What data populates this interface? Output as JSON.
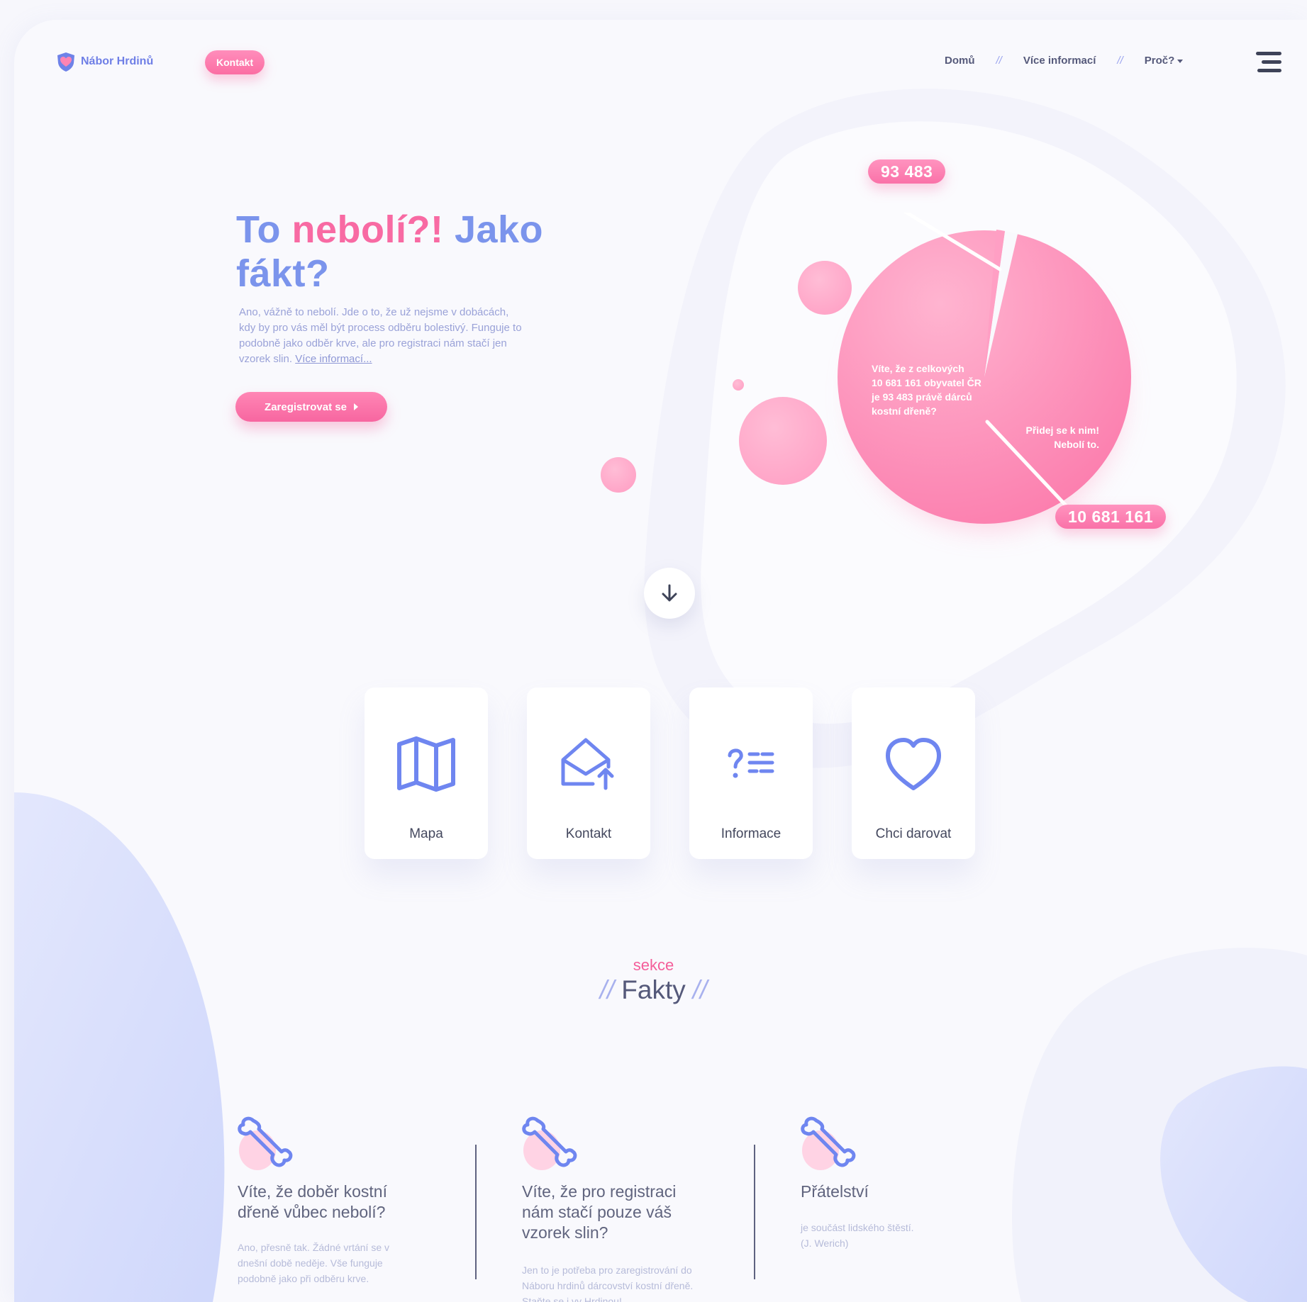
{
  "header": {
    "logo_text": "Nábor Hrdinů",
    "contact_pill": "Kontakt",
    "nav": {
      "home": "Domů",
      "more_info": "Více informací",
      "why": "Proč?",
      "separator": "//"
    }
  },
  "hero": {
    "title_part1": "To ",
    "title_pink": "nebolí?!",
    "title_part2": " Jako fákt?",
    "text": "Ano, vážně to nebolí. Jde o to, že už nejsme v dobácách, kdy by pro vás měl být process odběru bolestivý. Funguje to podobně jako odběr krve, ale pro registraci nám stačí jen vzorek slin.",
    "more_link": "Více informací...",
    "register_button": "Zaregistrovat se"
  },
  "stats": {
    "donors_pill": "93 483",
    "population_pill": "10 681 161",
    "question_lines": [
      "Víte, že z celkových",
      "10 681 161 obyvatel ČR",
      "je 93 483 právě dárců",
      "kostní dřeně?"
    ],
    "cta_line1": "Přidej se k nim!",
    "cta_line2": "Nebolí to."
  },
  "cards": [
    {
      "label": "Mapa",
      "icon": "map-icon"
    },
    {
      "label": "Kontakt",
      "icon": "mail-upload-icon"
    },
    {
      "label": "Informace",
      "icon": "question-list-icon"
    },
    {
      "label": "Chci darovat",
      "icon": "heart-icon"
    }
  ],
  "section": {
    "sub": "sekce",
    "title": "Fakty",
    "slashes": "//"
  },
  "facts": [
    {
      "title": "Víte, že doběr kostní dřeně vůbec nebolí?",
      "text": "Ano, přesně tak. Žádné vrtání se v dnešní době neděje. Vše funguje podobně jako při odběru krve.",
      "icon": "bone-icon"
    },
    {
      "title": "Víte, že pro registraci nám stačí pouze váš vzorek slin?",
      "text": "Jen to je potřeba pro zaregistrování do Náboru hrdinů dárcovství kostní dřeně. Staňte se i vy Hrdinou!",
      "icon": "bone-icon"
    },
    {
      "title": "Přátelství",
      "text": "je součást lidského štěstí.",
      "text2": "(J. Werich)",
      "icon": "bone-icon"
    }
  ],
  "colors": {
    "pink": "#f86aa3",
    "blue": "#7b94ec",
    "icon_blue": "#6f86f0",
    "dark": "#55597a"
  }
}
